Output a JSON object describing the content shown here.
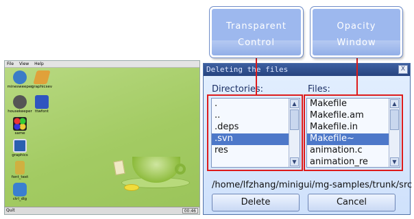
{
  "desktop": {
    "menu": [
      "File",
      "View",
      "Help"
    ],
    "icons": [
      {
        "label": "minesweeper",
        "icon": "mine-icon",
        "color": "#3a7cc8"
      },
      {
        "label": "graphicsev",
        "icon": "feather-icon",
        "color": "#e0a13a"
      },
      {
        "label": "housekeeper",
        "icon": "bomb-icon",
        "color": "#555555"
      },
      {
        "label": "ttwfont",
        "icon": "font-a-icon",
        "color": "#2f55c0"
      },
      {
        "label": "same",
        "icon": "balls-icon",
        "color": "#d03a3a"
      },
      {
        "label": "graphics",
        "icon": "picture-icon",
        "color": "#2a5fb0"
      },
      {
        "label": "font_text",
        "icon": "bottle-icon",
        "color": "#d0b040"
      },
      {
        "label": "ctrl_dlg",
        "icon": "chat-icon",
        "color": "#3a7fd0"
      }
    ],
    "taskbar": {
      "start_label": "Quit",
      "clock": "00:46"
    }
  },
  "dialog": {
    "title": "Deleting the files",
    "close_glyph": "X",
    "directories_label": "Directories:",
    "files_label": "Files:",
    "directories": [
      ".",
      "..",
      ".deps",
      ".svn",
      "res"
    ],
    "directories_selected": 3,
    "files": [
      "Makefile",
      "Makefile.am",
      "Makefile.in",
      "Makefile~",
      "animation.c",
      "animation_re"
    ],
    "files_selected": 3,
    "path": "/home/lfzhang/minigui/mg-samples/trunk/src",
    "delete_label": "Delete",
    "cancel_label": "Cancel",
    "scroll_up": "▲",
    "scroll_down": "▼"
  },
  "callouts": {
    "transparent": {
      "line1": "Transparent",
      "line2": "Control"
    },
    "opacity": {
      "line1": "Opacity",
      "line2": "Window"
    }
  },
  "colors": {
    "annotation": "#dd1a1a",
    "callout": "#9db8ee",
    "selection": "#4d78c9"
  }
}
